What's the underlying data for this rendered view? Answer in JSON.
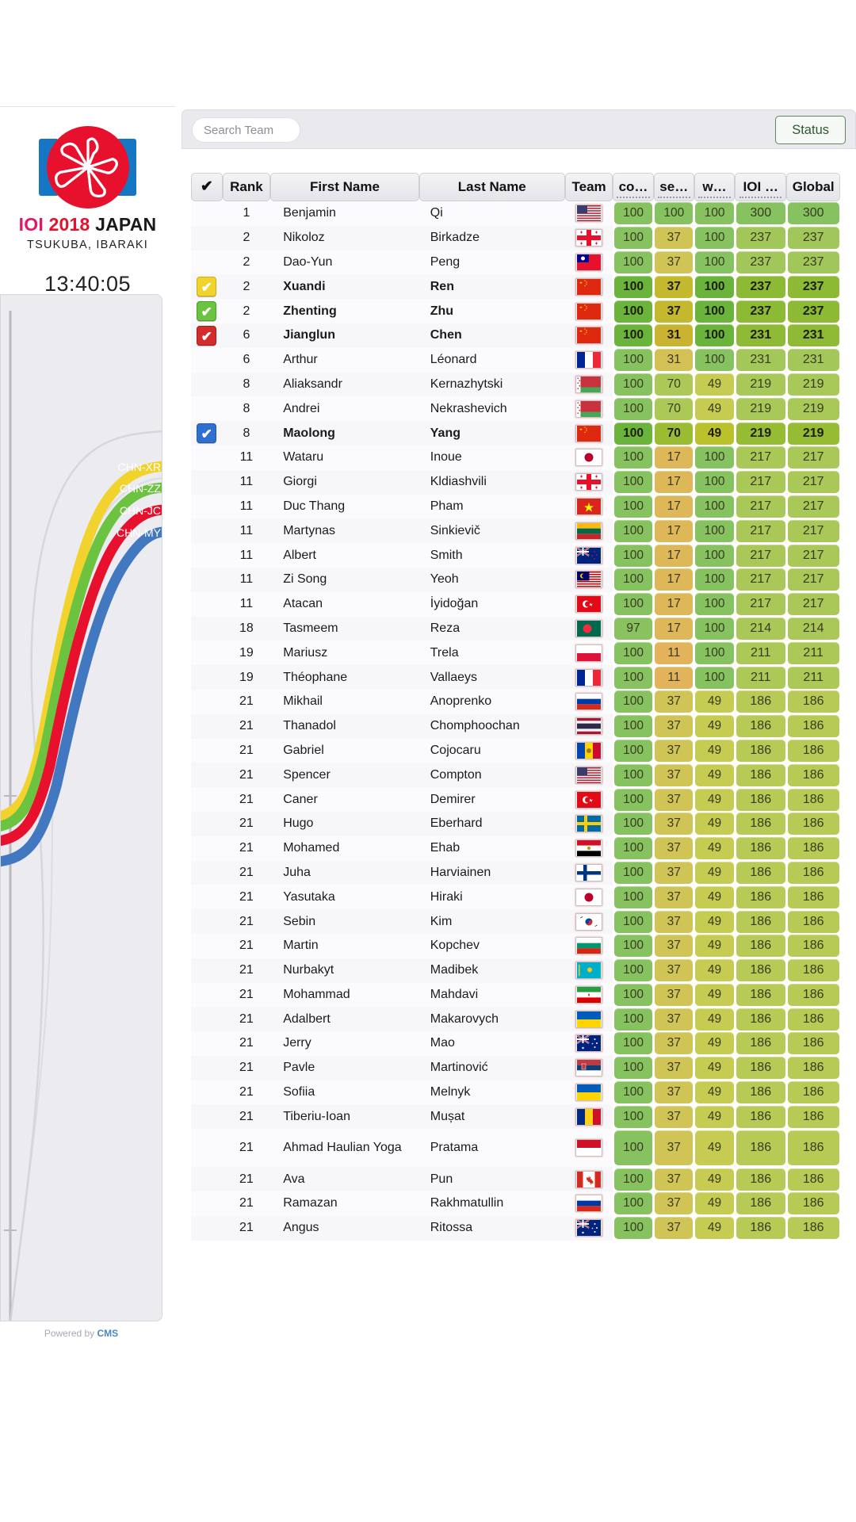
{
  "sidebar": {
    "logo": {
      "wordmark_ioi": "IOI",
      "wordmark_year": "2018",
      "wordmark_country": "JAPAN",
      "subline": "TSUKUBA, IBARAKI"
    },
    "clock": "13:40:05",
    "chart_legend": [
      "CHN-XR",
      "CHN-ZZ",
      "CHN-JC",
      "CHN-MY"
    ],
    "footer_prefix": "Powered by ",
    "footer_link": "CMS"
  },
  "toolbar": {
    "search_placeholder": "Search Team",
    "search_value": "",
    "status_label": "Status"
  },
  "table": {
    "headers": {
      "check": "✔",
      "rank": "Rank",
      "first": "First Name",
      "last": "Last Name",
      "team": "Team",
      "p1": "co…",
      "p2": "se…",
      "p3": "w…",
      "ioi": "IOI …",
      "global": "Global"
    },
    "rows": [
      {
        "mark": null,
        "rank": "1",
        "first": "Benjamin",
        "last": "Qi",
        "flag": "us",
        "bold": false,
        "p1": "100",
        "p2": "100",
        "p3": "100",
        "ioi": "300",
        "global": "300"
      },
      {
        "mark": null,
        "rank": "2",
        "first": "Nikoloz",
        "last": "Birkadze",
        "flag": "ge",
        "bold": false,
        "p1": "100",
        "p2": "37",
        "p3": "100",
        "ioi": "237",
        "global": "237"
      },
      {
        "mark": null,
        "rank": "2",
        "first": "Dao-Yun",
        "last": "Peng",
        "flag": "tw",
        "bold": false,
        "p1": "100",
        "p2": "37",
        "p3": "100",
        "ioi": "237",
        "global": "237"
      },
      {
        "mark": "yellow",
        "rank": "2",
        "first": "Xuandi",
        "last": "Ren",
        "flag": "cn",
        "bold": true,
        "p1": "100",
        "p2": "37",
        "p3": "100",
        "ioi": "237",
        "global": "237"
      },
      {
        "mark": "green",
        "rank": "2",
        "first": "Zhenting",
        "last": "Zhu",
        "flag": "cn",
        "bold": true,
        "p1": "100",
        "p2": "37",
        "p3": "100",
        "ioi": "237",
        "global": "237"
      },
      {
        "mark": "red",
        "rank": "6",
        "first": "Jianglun",
        "last": "Chen",
        "flag": "cn",
        "bold": true,
        "p1": "100",
        "p2": "31",
        "p3": "100",
        "ioi": "231",
        "global": "231"
      },
      {
        "mark": null,
        "rank": "6",
        "first": "Arthur",
        "last": "Léonard",
        "flag": "fr",
        "bold": false,
        "p1": "100",
        "p2": "31",
        "p3": "100",
        "ioi": "231",
        "global": "231"
      },
      {
        "mark": null,
        "rank": "8",
        "first": "Aliaksandr",
        "last": "Kernazhytski",
        "flag": "by",
        "bold": false,
        "p1": "100",
        "p2": "70",
        "p3": "49",
        "ioi": "219",
        "global": "219"
      },
      {
        "mark": null,
        "rank": "8",
        "first": "Andrei",
        "last": "Nekrashevich",
        "flag": "by",
        "bold": false,
        "p1": "100",
        "p2": "70",
        "p3": "49",
        "ioi": "219",
        "global": "219"
      },
      {
        "mark": "blue",
        "rank": "8",
        "first": "Maolong",
        "last": "Yang",
        "flag": "cn",
        "bold": true,
        "p1": "100",
        "p2": "70",
        "p3": "49",
        "ioi": "219",
        "global": "219"
      },
      {
        "mark": null,
        "rank": "11",
        "first": "Wataru",
        "last": "Inoue",
        "flag": "jp",
        "bold": false,
        "p1": "100",
        "p2": "17",
        "p3": "100",
        "ioi": "217",
        "global": "217"
      },
      {
        "mark": null,
        "rank": "11",
        "first": "Giorgi",
        "last": "Kldiashvili",
        "flag": "ge",
        "bold": false,
        "p1": "100",
        "p2": "17",
        "p3": "100",
        "ioi": "217",
        "global": "217"
      },
      {
        "mark": null,
        "rank": "11",
        "first": "Duc Thang",
        "last": "Pham",
        "flag": "vn",
        "bold": false,
        "p1": "100",
        "p2": "17",
        "p3": "100",
        "ioi": "217",
        "global": "217"
      },
      {
        "mark": null,
        "rank": "11",
        "first": "Martynas",
        "last": "Sinkievič",
        "flag": "lt",
        "bold": false,
        "p1": "100",
        "p2": "17",
        "p3": "100",
        "ioi": "217",
        "global": "217"
      },
      {
        "mark": null,
        "rank": "11",
        "first": "Albert",
        "last": "Smith",
        "flag": "nz",
        "bold": false,
        "p1": "100",
        "p2": "17",
        "p3": "100",
        "ioi": "217",
        "global": "217"
      },
      {
        "mark": null,
        "rank": "11",
        "first": "Zi Song",
        "last": "Yeoh",
        "flag": "my",
        "bold": false,
        "p1": "100",
        "p2": "17",
        "p3": "100",
        "ioi": "217",
        "global": "217"
      },
      {
        "mark": null,
        "rank": "11",
        "first": "Atacan",
        "last": "İyidoğan",
        "flag": "tr",
        "bold": false,
        "p1": "100",
        "p2": "17",
        "p3": "100",
        "ioi": "217",
        "global": "217"
      },
      {
        "mark": null,
        "rank": "18",
        "first": "Tasmeem",
        "last": "Reza",
        "flag": "bd",
        "bold": false,
        "p1": "97",
        "p2": "17",
        "p3": "100",
        "ioi": "214",
        "global": "214"
      },
      {
        "mark": null,
        "rank": "19",
        "first": "Mariusz",
        "last": "Trela",
        "flag": "pl",
        "bold": false,
        "p1": "100",
        "p2": "11",
        "p3": "100",
        "ioi": "211",
        "global": "211"
      },
      {
        "mark": null,
        "rank": "19",
        "first": "Théophane",
        "last": "Vallaeys",
        "flag": "fr",
        "bold": false,
        "p1": "100",
        "p2": "11",
        "p3": "100",
        "ioi": "211",
        "global": "211"
      },
      {
        "mark": null,
        "rank": "21",
        "first": "Mikhail",
        "last": "Anoprenko",
        "flag": "ru",
        "bold": false,
        "p1": "100",
        "p2": "37",
        "p3": "49",
        "ioi": "186",
        "global": "186"
      },
      {
        "mark": null,
        "rank": "21",
        "first": "Thanadol",
        "last": "Chomphoochan",
        "flag": "th",
        "bold": false,
        "p1": "100",
        "p2": "37",
        "p3": "49",
        "ioi": "186",
        "global": "186"
      },
      {
        "mark": null,
        "rank": "21",
        "first": "Gabriel",
        "last": "Cojocaru",
        "flag": "md",
        "bold": false,
        "p1": "100",
        "p2": "37",
        "p3": "49",
        "ioi": "186",
        "global": "186"
      },
      {
        "mark": null,
        "rank": "21",
        "first": "Spencer",
        "last": "Compton",
        "flag": "us",
        "bold": false,
        "p1": "100",
        "p2": "37",
        "p3": "49",
        "ioi": "186",
        "global": "186"
      },
      {
        "mark": null,
        "rank": "21",
        "first": "Caner",
        "last": "Demirer",
        "flag": "tr",
        "bold": false,
        "p1": "100",
        "p2": "37",
        "p3": "49",
        "ioi": "186",
        "global": "186"
      },
      {
        "mark": null,
        "rank": "21",
        "first": "Hugo",
        "last": "Eberhard",
        "flag": "se",
        "bold": false,
        "p1": "100",
        "p2": "37",
        "p3": "49",
        "ioi": "186",
        "global": "186"
      },
      {
        "mark": null,
        "rank": "21",
        "first": "Mohamed",
        "last": "Ehab",
        "flag": "eg",
        "bold": false,
        "p1": "100",
        "p2": "37",
        "p3": "49",
        "ioi": "186",
        "global": "186"
      },
      {
        "mark": null,
        "rank": "21",
        "first": "Juha",
        "last": "Harviainen",
        "flag": "fi",
        "bold": false,
        "p1": "100",
        "p2": "37",
        "p3": "49",
        "ioi": "186",
        "global": "186"
      },
      {
        "mark": null,
        "rank": "21",
        "first": "Yasutaka",
        "last": "Hiraki",
        "flag": "jp",
        "bold": false,
        "p1": "100",
        "p2": "37",
        "p3": "49",
        "ioi": "186",
        "global": "186"
      },
      {
        "mark": null,
        "rank": "21",
        "first": "Sebin",
        "last": "Kim",
        "flag": "kr",
        "bold": false,
        "p1": "100",
        "p2": "37",
        "p3": "49",
        "ioi": "186",
        "global": "186"
      },
      {
        "mark": null,
        "rank": "21",
        "first": "Martin",
        "last": "Kopchev",
        "flag": "bg",
        "bold": false,
        "p1": "100",
        "p2": "37",
        "p3": "49",
        "ioi": "186",
        "global": "186"
      },
      {
        "mark": null,
        "rank": "21",
        "first": "Nurbakyt",
        "last": "Madibek",
        "flag": "kz",
        "bold": false,
        "p1": "100",
        "p2": "37",
        "p3": "49",
        "ioi": "186",
        "global": "186"
      },
      {
        "mark": null,
        "rank": "21",
        "first": "Mohammad",
        "last": "Mahdavi",
        "flag": "ir",
        "bold": false,
        "p1": "100",
        "p2": "37",
        "p3": "49",
        "ioi": "186",
        "global": "186"
      },
      {
        "mark": null,
        "rank": "21",
        "first": "Adalbert",
        "last": "Makarovych",
        "flag": "ua",
        "bold": false,
        "p1": "100",
        "p2": "37",
        "p3": "49",
        "ioi": "186",
        "global": "186"
      },
      {
        "mark": null,
        "rank": "21",
        "first": "Jerry",
        "last": "Mao",
        "flag": "au",
        "bold": false,
        "p1": "100",
        "p2": "37",
        "p3": "49",
        "ioi": "186",
        "global": "186"
      },
      {
        "mark": null,
        "rank": "21",
        "first": "Pavle",
        "last": "Martinović",
        "flag": "rs",
        "bold": false,
        "p1": "100",
        "p2": "37",
        "p3": "49",
        "ioi": "186",
        "global": "186"
      },
      {
        "mark": null,
        "rank": "21",
        "first": "Sofiia",
        "last": "Melnyk",
        "flag": "ua",
        "bold": false,
        "p1": "100",
        "p2": "37",
        "p3": "49",
        "ioi": "186",
        "global": "186"
      },
      {
        "mark": null,
        "rank": "21",
        "first": "Tiberiu-Ioan",
        "last": "Mușat",
        "flag": "ro",
        "bold": false,
        "p1": "100",
        "p2": "37",
        "p3": "49",
        "ioi": "186",
        "global": "186"
      },
      {
        "mark": null,
        "rank": "21",
        "first": "Ahmad Haulian Yoga",
        "last": "Pratama",
        "flag": "id",
        "bold": false,
        "p1": "100",
        "p2": "37",
        "p3": "49",
        "ioi": "186",
        "global": "186",
        "tall": true
      },
      {
        "mark": null,
        "rank": "21",
        "first": "Ava",
        "last": "Pun",
        "flag": "ca",
        "bold": false,
        "p1": "100",
        "p2": "37",
        "p3": "49",
        "ioi": "186",
        "global": "186"
      },
      {
        "mark": null,
        "rank": "21",
        "first": "Ramazan",
        "last": "Rakhmatullin",
        "flag": "ru",
        "bold": false,
        "p1": "100",
        "p2": "37",
        "p3": "49",
        "ioi": "186",
        "global": "186"
      },
      {
        "mark": null,
        "rank": "21",
        "first": "Angus",
        "last": "Ritossa",
        "flag": "au",
        "bold": false,
        "p1": "100",
        "p2": "37",
        "p3": "49",
        "ioi": "186",
        "global": "186"
      }
    ]
  },
  "colors": {
    "brand_red": "#e8112d",
    "brand_blue": "#1577c4",
    "brand_pink": "#e2176a",
    "mark_yellow": "#f2d32e",
    "mark_green": "#6cc33f",
    "mark_red": "#d42b2b",
    "mark_blue": "#2f6fd0",
    "score_green": "#76bf43",
    "score_orange": "#e59a38",
    "score_yellowgreen": "#b9c22c",
    "status_border": "#5d8a5d"
  },
  "chart_data": {
    "type": "line",
    "title": "",
    "series": [
      {
        "name": "CHN-XR",
        "color": "#f2d32e"
      },
      {
        "name": "CHN-ZZ",
        "color": "#6cc33f"
      },
      {
        "name": "CHN-JC",
        "color": "#d42b2b"
      },
      {
        "name": "CHN-MY",
        "color": "#2f6fd0"
      }
    ],
    "xlabel": "",
    "ylabel": "",
    "grid": false,
    "legend_position": "inline-right"
  }
}
